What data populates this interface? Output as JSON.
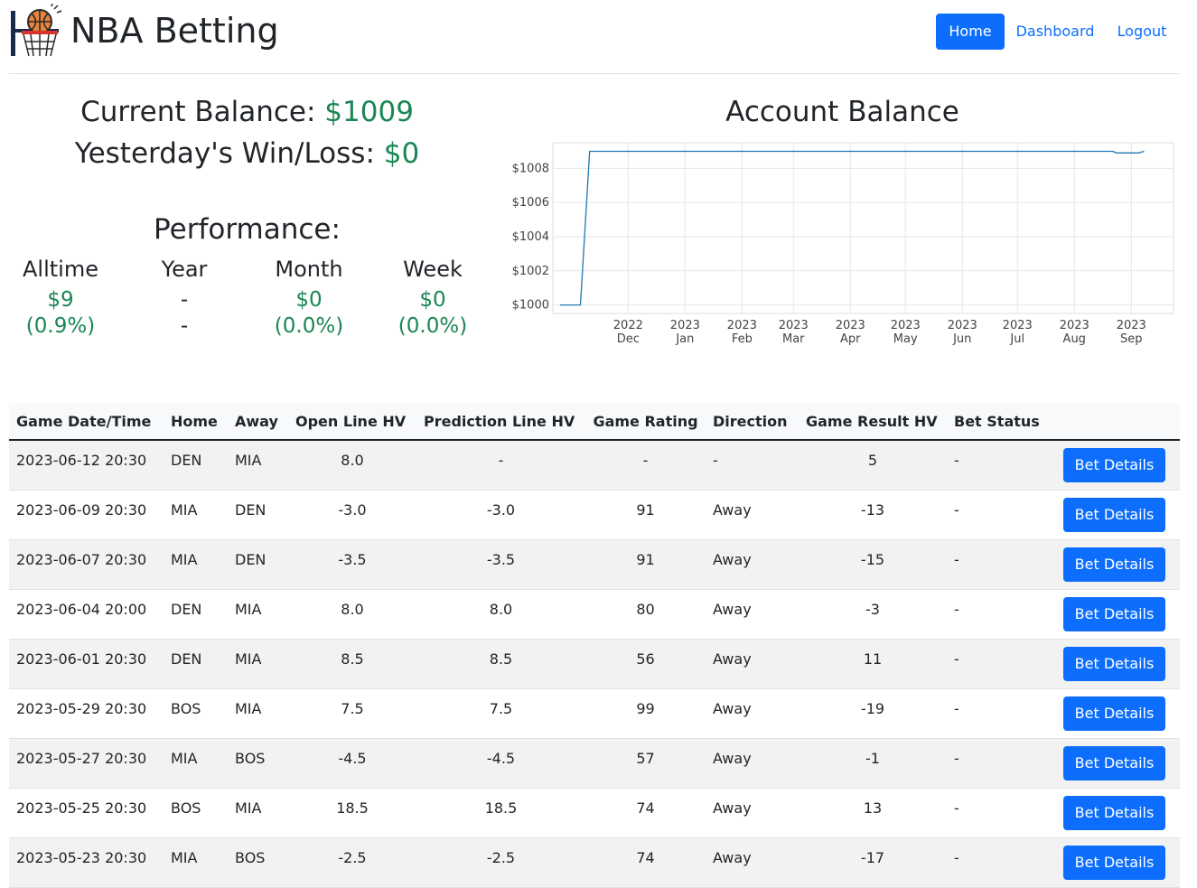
{
  "nav": {
    "brand": "NBA Betting",
    "home": "Home",
    "dashboard": "Dashboard",
    "logout": "Logout"
  },
  "summary": {
    "balance_label": "Current Balance:",
    "balance_value": "$1009",
    "winloss_label": "Yesterday's Win/Loss:",
    "winloss_value": "$0"
  },
  "performance": {
    "title": "Performance:",
    "columns": [
      {
        "label": "Alltime",
        "value": "$9",
        "pct": "(0.9%)"
      },
      {
        "label": "Year",
        "value": "-",
        "pct": "-"
      },
      {
        "label": "Month",
        "value": "$0",
        "pct": "(0.0%)"
      },
      {
        "label": "Week",
        "value": "$0",
        "pct": "(0.0%)"
      }
    ]
  },
  "chart_data": {
    "type": "line",
    "title": "Account Balance",
    "xlabel": "",
    "ylabel": "",
    "ylim": [
      999.5,
      1009.5
    ],
    "yticks": [
      "$1000",
      "$1002",
      "$1004",
      "$1006",
      "$1008"
    ],
    "ytick_values": [
      1000,
      1002,
      1004,
      1006,
      1008
    ],
    "xticks": [
      {
        "top": "2022",
        "bottom": "Dec",
        "date": "2022-12-01"
      },
      {
        "top": "2023",
        "bottom": "Jan",
        "date": "2023-01-01"
      },
      {
        "top": "2023",
        "bottom": "Feb",
        "date": "2023-02-01"
      },
      {
        "top": "2023",
        "bottom": "Mar",
        "date": "2023-03-01"
      },
      {
        "top": "2023",
        "bottom": "Apr",
        "date": "2023-04-01"
      },
      {
        "top": "2023",
        "bottom": "May",
        "date": "2023-05-01"
      },
      {
        "top": "2023",
        "bottom": "Jun",
        "date": "2023-06-01"
      },
      {
        "top": "2023",
        "bottom": "Jul",
        "date": "2023-07-01"
      },
      {
        "top": "2023",
        "bottom": "Aug",
        "date": "2023-08-01"
      },
      {
        "top": "2023",
        "bottom": "Sep",
        "date": "2023-09-01"
      }
    ],
    "xrange": [
      "2022-10-21",
      "2023-09-24"
    ],
    "series": [
      {
        "color": "#1f77b4",
        "points": [
          {
            "x": "2022-10-25",
            "y": 1000
          },
          {
            "x": "2022-11-05",
            "y": 1000
          },
          {
            "x": "2022-11-10",
            "y": 1009
          },
          {
            "x": "2023-08-22",
            "y": 1009
          },
          {
            "x": "2023-08-24",
            "y": 1008.9
          },
          {
            "x": "2023-09-05",
            "y": 1008.9
          },
          {
            "x": "2023-09-08",
            "y": 1009
          }
        ]
      }
    ],
    "grid": true,
    "line_color": "#1f77b4"
  },
  "table": {
    "headers": [
      "Game Date/Time",
      "Home",
      "Away",
      "Open Line HV",
      "Prediction Line HV",
      "Game Rating",
      "Direction",
      "Game Result HV",
      "Bet Status",
      ""
    ],
    "button_label": "Bet Details",
    "rows": [
      [
        "2023-06-12 20:30",
        "DEN",
        "MIA",
        "8.0",
        "-",
        "-",
        "-",
        "5",
        "-"
      ],
      [
        "2023-06-09 20:30",
        "MIA",
        "DEN",
        "-3.0",
        "-3.0",
        "91",
        "Away",
        "-13",
        "-"
      ],
      [
        "2023-06-07 20:30",
        "MIA",
        "DEN",
        "-3.5",
        "-3.5",
        "91",
        "Away",
        "-15",
        "-"
      ],
      [
        "2023-06-04 20:00",
        "DEN",
        "MIA",
        "8.0",
        "8.0",
        "80",
        "Away",
        "-3",
        "-"
      ],
      [
        "2023-06-01 20:30",
        "DEN",
        "MIA",
        "8.5",
        "8.5",
        "56",
        "Away",
        "11",
        "-"
      ],
      [
        "2023-05-29 20:30",
        "BOS",
        "MIA",
        "7.5",
        "7.5",
        "99",
        "Away",
        "-19",
        "-"
      ],
      [
        "2023-05-27 20:30",
        "MIA",
        "BOS",
        "-4.5",
        "-4.5",
        "57",
        "Away",
        "-1",
        "-"
      ],
      [
        "2023-05-25 20:30",
        "BOS",
        "MIA",
        "18.5",
        "18.5",
        "74",
        "Away",
        "13",
        "-"
      ],
      [
        "2023-05-23 20:30",
        "MIA",
        "BOS",
        "-2.5",
        "-2.5",
        "74",
        "Away",
        "-17",
        "-"
      ]
    ]
  }
}
